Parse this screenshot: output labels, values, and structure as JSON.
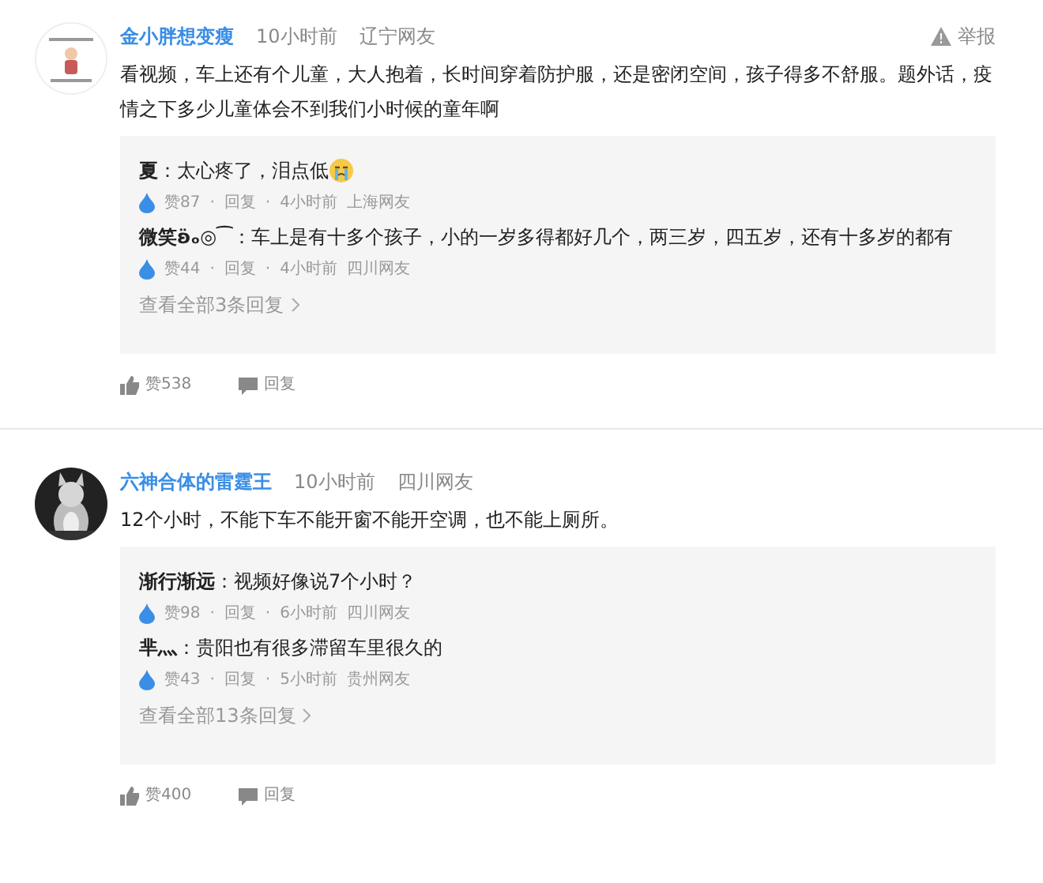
{
  "separator": "·",
  "comments": [
    {
      "author": "金小胖想变瘦",
      "time": "10小时前",
      "location": "辽宁网友",
      "report": "举报",
      "text": "看视频，车上还有个儿童，大人抱着，长时间穿着防护服，还是密闭空间，孩子得多不舒服。题外话，疫情之下多少儿童体会不到我们小时候的童年啊",
      "replies": [
        {
          "author": "夏",
          "text": "：太心疼了，泪点低",
          "emoji": true,
          "likes": "赞87",
          "reply": "回复",
          "time": "4小时前",
          "location": "上海网友"
        },
        {
          "author": "微笑ʚ̈ₒ◎⁀",
          "text": "：车上是有十多个孩子，小的一岁多得都好几个，两三岁，四五岁，还有十多岁的都有",
          "emoji": false,
          "likes": "赞44",
          "reply": "回复",
          "time": "4小时前",
          "location": "四川网友"
        }
      ],
      "more": "查看全部3条回复",
      "likes": "赞538",
      "reply": "回复"
    },
    {
      "author": "六神合体的雷霆王",
      "time": "10小时前",
      "location": "四川网友",
      "text": "12个小时，不能下车不能开窗不能开空调，也不能上厕所。",
      "replies": [
        {
          "author": "渐行渐远",
          "text": "：视频好像说7个小时？",
          "emoji": false,
          "likes": "赞98",
          "reply": "回复",
          "time": "6小时前",
          "location": "四川网友"
        },
        {
          "author": "芈灬",
          "text": "：贵阳也有很多滞留车里很久的",
          "emoji": false,
          "likes": "赞43",
          "reply": "回复",
          "time": "5小时前",
          "location": "贵州网友"
        }
      ],
      "more": "查看全部13条回复",
      "likes": "赞400",
      "reply": "回复"
    }
  ]
}
